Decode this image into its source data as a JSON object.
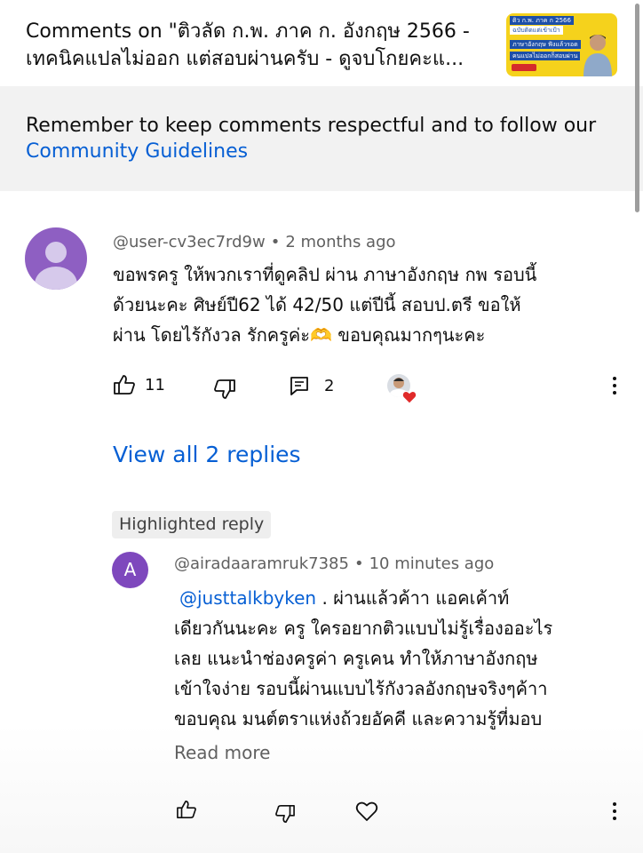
{
  "header": {
    "title_line1": "Comments on \"ติวลัด ก.พ. ภาค ก. อังกฤษ 2566 -",
    "title_line2": "เทคนิคแปลไม่ออก แต่สอบผ่านครับ - ดูจบโกยคะแ...",
    "thumbnail": {
      "line1": "ติว ก.พ. ภาค ก 2566",
      "line2": "ฉบับติดแต่เข้าเป้า",
      "line3": "ภาษาอังกฤษ ฟังแล้วรอด",
      "line4": "คนแปลไม่ออกก็สอบผ่าน"
    }
  },
  "notice": {
    "text": "Remember to keep comments respectful and to follow our",
    "link": "Community Guidelines"
  },
  "comment": {
    "author": "@user-cv3ec7rd9w",
    "separator": "•",
    "time": "2 months ago",
    "lines": [
      "ขอพรครู ให้พวกเราที่ดูคลิป ผ่าน ภาษาอังกฤษ กพ รอบนี้",
      "ด้วยนะคะ  ศิษย์ปี62  ได้ 42/50 แต่ปีนี้ สอบป.ตรี ขอให้",
      "ผ่าน โดยไร้กังวล รักครูค่ะ🫶 ขอบคุณมากๆนะคะ"
    ],
    "likes": "11",
    "replies_count": "2",
    "icons": {
      "like": "thumbs-up-icon",
      "dislike": "thumbs-down-icon",
      "reply": "comment-icon",
      "creator_heart": "heart-icon",
      "more": "more-vert-icon"
    }
  },
  "view_replies": "View all 2 replies",
  "reply": {
    "badge": "Highlighted reply",
    "avatar_letter": "A",
    "author": "@airadaaramruk7385",
    "separator": "•",
    "time": "10 minutes ago",
    "mention": "@justtalkbyken",
    "first_line_rest": " . ผ่านแล้วค้าา แอคเค้าท์",
    "lines": [
      "เดียวกันนะคะ ครู  ใครอยากติวแบบไม่รู้เรื่องออะไร",
      "เลย  แนะนำช่องครูค่า ครูเคน ทำให้ภาษาอังกฤษ",
      "เข้าใจง่าย รอบนี้ผ่านแบบไร้กังวลอังกฤษจริงๆค้าา",
      "ขอบคุณ มนต์ตราแห่งถ้วยอัคคี และความรู้ที่มอบ"
    ],
    "read_more": "Read more"
  },
  "colors": {
    "link_blue": "#065fd4",
    "avatar_purple": "#8e5fc2",
    "reply_avatar": "#7e48bd",
    "notice_bg": "#f2f2f2",
    "heart_red": "#e02a2a"
  }
}
